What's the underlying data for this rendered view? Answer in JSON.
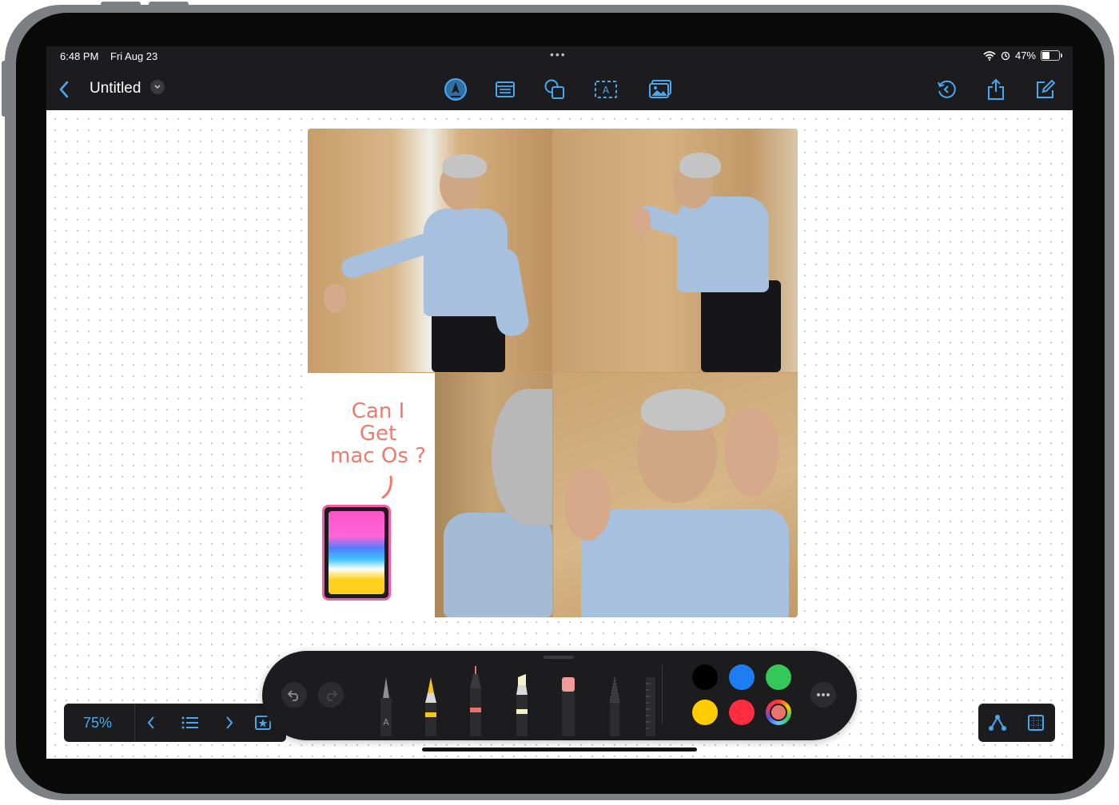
{
  "status_bar": {
    "time": "6:48 PM",
    "date": "Fri Aug 23",
    "battery": "47%",
    "battery_level": 0.47
  },
  "toolbar": {
    "back_icon": "chevron-left-icon",
    "title": "Untitled",
    "title_menu_icon": "chevron-down-icon",
    "center_tools": [
      "pen-markup-icon",
      "sticky-note-icon",
      "shapes-icon",
      "text-box-icon",
      "insert-media-icon"
    ],
    "right_tools": [
      "history-icon",
      "share-icon",
      "compose-icon"
    ]
  },
  "canvas": {
    "handwritten_note": [
      "Can I",
      "Get",
      "mac Os ?"
    ],
    "images": [
      "person-walking-hallway",
      "person-touching-wall",
      "person-back-turned",
      "person-waving-hands"
    ],
    "device_sticker": "ipad-device"
  },
  "navigation": {
    "zoom": "75%",
    "buttons": [
      "previous-icon",
      "scene-list-icon",
      "next-icon",
      "favorite-scene-icon"
    ]
  },
  "drawing_tools": {
    "undo_icon": "undo-icon",
    "redo_icon": "redo-icon",
    "tools": [
      {
        "name": "monoline-pen",
        "label": "A",
        "band": ""
      },
      {
        "name": "pen",
        "label": "",
        "band": "#f5c518"
      },
      {
        "name": "fineliner",
        "label": "",
        "band": "#e8736c"
      },
      {
        "name": "highlighter",
        "label": "",
        "band": "#f4f0c8"
      },
      {
        "name": "eraser",
        "label": "",
        "band": "#f29a9a"
      },
      {
        "name": "lasso",
        "label": "",
        "band": ""
      },
      {
        "name": "ruler",
        "label": "",
        "band": ""
      }
    ],
    "colors": [
      "#000000",
      "#1e7df2",
      "#34c759",
      "#ffcc00",
      "#ff2d3f",
      "#e9736d"
    ],
    "selected_color": "#e9736d",
    "more_icon": "ellipsis-icon"
  },
  "bottom_right": {
    "buttons": [
      "connector-icon",
      "grid-icon"
    ]
  },
  "colors": {
    "accent": "#48a8f0",
    "toolbar_bg": "#1c1c1e"
  }
}
